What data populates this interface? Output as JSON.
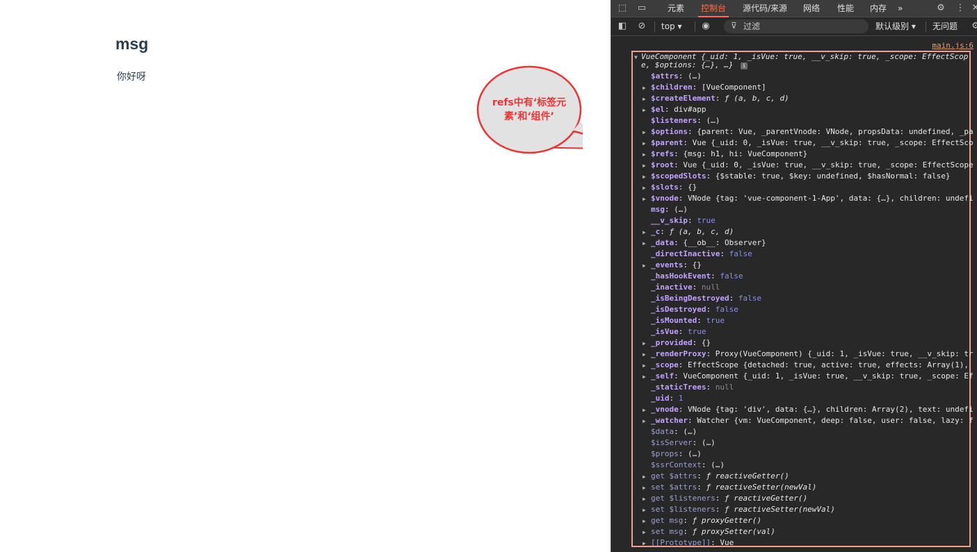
{
  "page": {
    "heading": "msg",
    "paragraph": "你好呀"
  },
  "devtools": {
    "tabs": [
      "元素",
      "控制台",
      "源代码/来源",
      "网络",
      "性能",
      "内存"
    ],
    "active_tab": "控制台",
    "more": "»",
    "toolbar": {
      "context": "top",
      "filter_placeholder": "过滤",
      "levels": "默认级别",
      "issues": "无问题"
    },
    "source_link": "main.js:6",
    "summary_line_1": "VueComponent {_uid: 1, _isVue: true, __v_skip: true, _scope: EffectScop",
    "summary_line_2": "e, $options: {…}, …}",
    "info_badge": "i",
    "properties": [
      {
        "e": false,
        "k": "$attrs",
        "v": "(…)"
      },
      {
        "e": true,
        "k": "$children",
        "v": "[VueComponent]"
      },
      {
        "e": true,
        "k": "$createElement",
        "v": "ƒ (a, b, c, d)"
      },
      {
        "e": true,
        "k": "$el",
        "v": "div#app"
      },
      {
        "e": false,
        "k": "$listeners",
        "v": "(…)"
      },
      {
        "e": true,
        "k": "$options",
        "v": "{parent: Vue, _parentVnode: VNode, propsData: undefined, _pa"
      },
      {
        "e": true,
        "k": "$parent",
        "v": "Vue {_uid: 0, _isVue: true, __v_skip: true, _scope: EffectSco"
      },
      {
        "e": true,
        "k": "$refs",
        "v": "{msg: h1, hi: VueComponent}"
      },
      {
        "e": true,
        "k": "$root",
        "v": "Vue {_uid: 0, _isVue: true, __v_skip: true, _scope: EffectScope"
      },
      {
        "e": true,
        "k": "$scopedSlots",
        "v": "{$stable: true, $key: undefined, $hasNormal: false}"
      },
      {
        "e": true,
        "k": "$slots",
        "v": "{}"
      },
      {
        "e": true,
        "k": "$vnode",
        "v": "VNode {tag: 'vue-component-1-App', data: {…}, children: undefi"
      },
      {
        "e": false,
        "k": "msg",
        "v": "(…)"
      },
      {
        "e": false,
        "k": "__v_skip",
        "v": "true"
      },
      {
        "e": true,
        "k": "_c",
        "v": "ƒ (a, b, c, d)"
      },
      {
        "e": true,
        "k": "_data",
        "v": "{__ob__: Observer}"
      },
      {
        "e": false,
        "k": "_directInactive",
        "v": "false"
      },
      {
        "e": true,
        "k": "_events",
        "v": "{}"
      },
      {
        "e": false,
        "k": "_hasHookEvent",
        "v": "false"
      },
      {
        "e": false,
        "k": "_inactive",
        "v": "null"
      },
      {
        "e": false,
        "k": "_isBeingDestroyed",
        "v": "false"
      },
      {
        "e": false,
        "k": "_isDestroyed",
        "v": "false"
      },
      {
        "e": false,
        "k": "_isMounted",
        "v": "true"
      },
      {
        "e": false,
        "k": "_isVue",
        "v": "true"
      },
      {
        "e": true,
        "k": "_provided",
        "v": "{}"
      },
      {
        "e": true,
        "k": "_renderProxy",
        "v": "Proxy(VueComponent) {_uid: 1, _isVue: true, __v_skip: tr"
      },
      {
        "e": true,
        "k": "_scope",
        "v": "EffectScope {detached: true, active: true, effects: Array(1),"
      },
      {
        "e": true,
        "k": "_self",
        "v": "VueComponent {_uid: 1, _isVue: true, __v_skip: true, _scope: Ef"
      },
      {
        "e": false,
        "k": "_staticTrees",
        "v": "null"
      },
      {
        "e": false,
        "k": "_uid",
        "v": "1"
      },
      {
        "e": true,
        "k": "_vnode",
        "v": "VNode {tag: 'div', data: {…}, children: Array(2), text: undefi"
      },
      {
        "e": true,
        "k": "_watcher",
        "v": "Watcher {vm: VueComponent, deep: false, user: false, lazy: f"
      },
      {
        "e": false,
        "k": "$data",
        "v": "(…)",
        "dim": true
      },
      {
        "e": false,
        "k": "$isServer",
        "v": "(…)",
        "dim": true
      },
      {
        "e": false,
        "k": "$props",
        "v": "(…)",
        "dim": true
      },
      {
        "e": false,
        "k": "$ssrContext",
        "v": "(…)",
        "dim": true
      },
      {
        "e": true,
        "k": "get $attrs",
        "v": "ƒ reactiveGetter()",
        "dim": true
      },
      {
        "e": true,
        "k": "set $attrs",
        "v": "ƒ reactiveSetter(newVal)",
        "dim": true
      },
      {
        "e": true,
        "k": "get $listeners",
        "v": "ƒ reactiveGetter()",
        "dim": true
      },
      {
        "e": true,
        "k": "set $listeners",
        "v": "ƒ reactiveSetter(newVal)",
        "dim": true
      },
      {
        "e": true,
        "k": "get msg",
        "v": "ƒ proxyGetter()",
        "dim": true
      },
      {
        "e": true,
        "k": "set msg",
        "v": "ƒ proxySetter(val)",
        "dim": true
      },
      {
        "e": true,
        "k": "[[Prototype]]",
        "v": "Vue",
        "dim": true
      }
    ]
  },
  "callout": {
    "line1": "refs中有‘标签元",
    "line2": "素’和‘组件’"
  }
}
